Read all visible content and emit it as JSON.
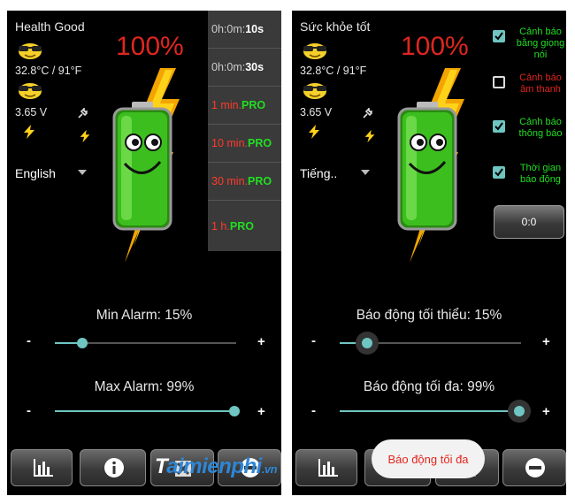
{
  "colors": {
    "accent": "#6fc5c1",
    "alert_red": "#e0261f",
    "pro_green": "#22dd22",
    "checked_green": "#22dd22",
    "battery_green": "#3cbf1e",
    "bolt_yellow": "#ffd21a"
  },
  "left": {
    "health": "Health Good",
    "temperature": "32.8°C / 91°F",
    "voltage": "3.65 V",
    "percent": "100%",
    "language": "English",
    "timer_menu": [
      {
        "prefix": "0h:0m:",
        "value": "10s",
        "pro": ""
      },
      {
        "prefix": "0h:0m:",
        "value": "30s",
        "pro": ""
      },
      {
        "prefix": "1 min.",
        "value": "",
        "pro": "PRO"
      },
      {
        "prefix": "10 min.",
        "value": "",
        "pro": "PRO"
      },
      {
        "prefix": "30 min.",
        "value": "",
        "pro": "PRO"
      },
      {
        "prefix": "1 h.",
        "value": "",
        "pro": "PRO"
      }
    ],
    "min_alarm": "Min Alarm: 15%",
    "max_alarm": "Max Alarm: 99%",
    "min_value": 15,
    "max_value": 99,
    "minus": "-",
    "plus": "+"
  },
  "right": {
    "health": "Sức khỏe tốt",
    "temperature": "32.8°C / 91°F",
    "voltage": "3.65 V",
    "percent": "100%",
    "language": "Tiếng..",
    "options": [
      {
        "label": "Cảnh báo bằng giọng nói",
        "checked": true
      },
      {
        "label": "Cảnh báo âm thanh",
        "checked": false
      },
      {
        "label": "Cảnh báo thông báo",
        "checked": true
      },
      {
        "label": "Thời gian báo động",
        "checked": true
      }
    ],
    "time_value": "0:0",
    "min_alarm": "Báo động tối thiểu: 15%",
    "max_alarm": "Báo động tối đa: 99%",
    "min_value": 15,
    "max_value": 99,
    "toast": "Báo động tối đa",
    "minus": "-",
    "plus": "+"
  },
  "watermark": {
    "prefix": "T",
    "mid": "aimienphi",
    "suffix": ".vn"
  }
}
